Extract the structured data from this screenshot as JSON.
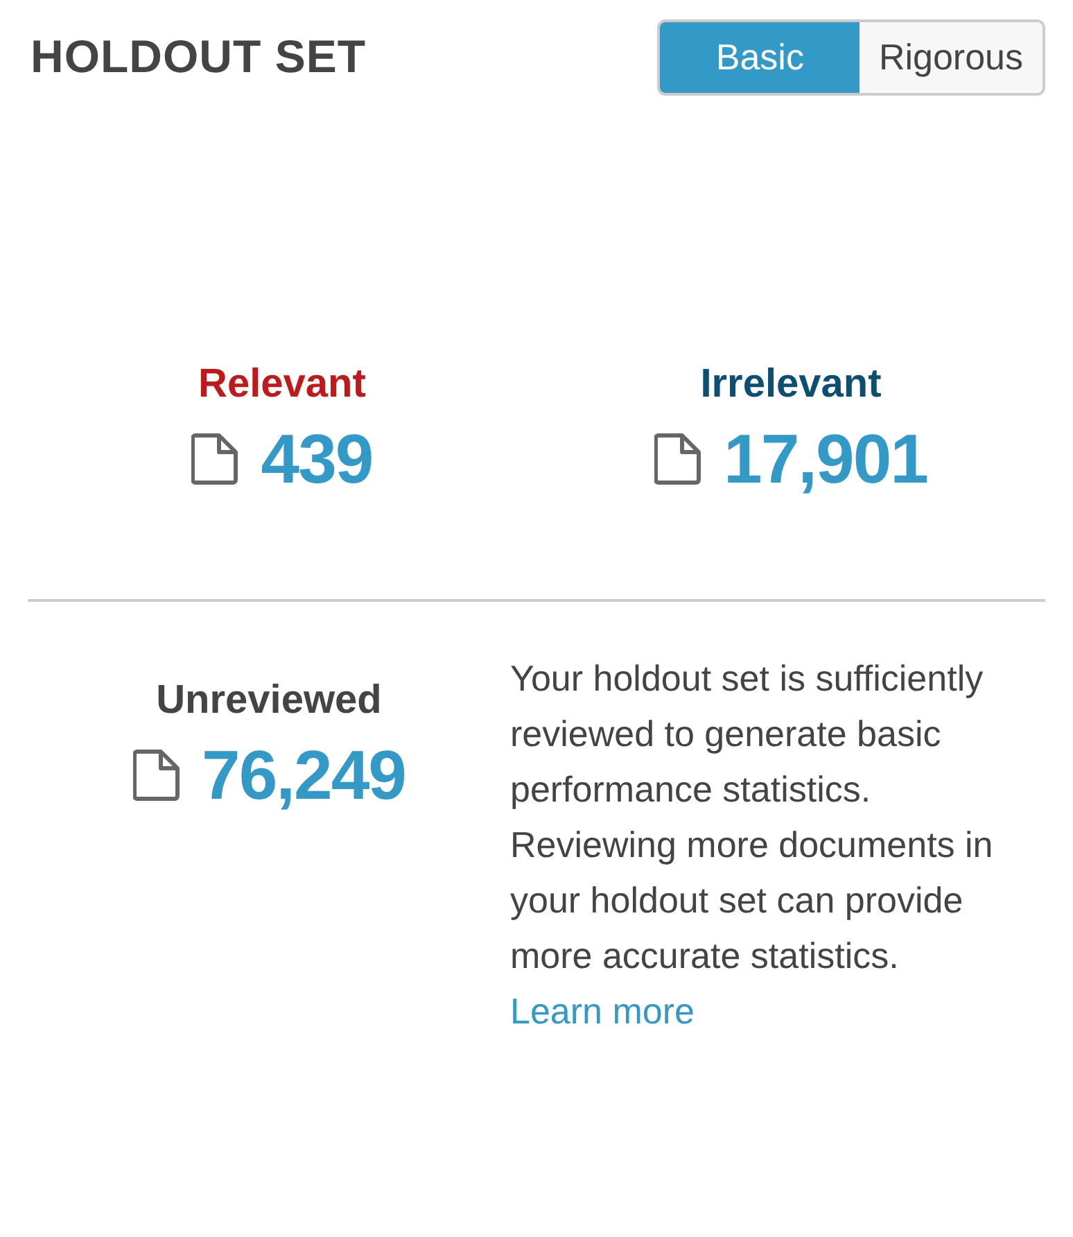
{
  "title": "HOLDOUT SET",
  "mode_toggle": [
    {
      "label": "Basic",
      "selected": true
    },
    {
      "label": "Rigorous",
      "selected": false
    }
  ],
  "stats": [
    {
      "label": "Relevant",
      "count": "439",
      "color": "#c0191b"
    },
    {
      "label": "Irrelevant",
      "count": "17,901",
      "color": "#0d4f73"
    }
  ],
  "unreviewed": {
    "label": "Unreviewed",
    "count": "76,249",
    "color": "#444444"
  },
  "description": "Your holdout set is sufficiently reviewed to generate basic performance statistics. Reviewing more documents in your holdout set can provide more accurate statistics.",
  "link": "Learn more"
}
